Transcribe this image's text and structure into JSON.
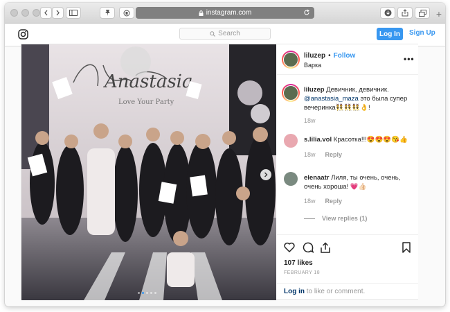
{
  "browser": {
    "url": "instagram.com",
    "icons": [
      "back-icon",
      "forward-icon",
      "sidebar-icon",
      "pin-icon",
      "privacy-icon",
      "lock-icon",
      "reload-icon",
      "download-icon",
      "share-icon",
      "tabs-icon",
      "new-tab-icon"
    ]
  },
  "header": {
    "search_placeholder": "Search",
    "login_label": "Log In",
    "signup_label": "Sign Up",
    "brand_color": "#3897f0"
  },
  "post": {
    "username": "liluzep",
    "separator": "•",
    "follow_label": "Follow",
    "location": "Варка",
    "more_label": "•••",
    "caption": {
      "username": "liluzep",
      "text_before": "Девичник, девичник.",
      "mention": "@anastasia_maza",
      "text_after": "это была супер вечеринка👯👯👯👌!",
      "time": "18w"
    },
    "comments": [
      {
        "username": "s.lilia.vol",
        "text": "Красотка!!!😍😍😍😘👍",
        "time": "18w",
        "reply_label": "Reply"
      },
      {
        "username": "elenaatr",
        "text": "Лиля, ты очень, очень, очень хороша! 💗👍🏻",
        "time": "18w",
        "reply_label": "Reply"
      }
    ],
    "view_replies": "View replies (1)",
    "likes": "107 likes",
    "date": "FEBRUARY 18",
    "login_link": "Log in",
    "login_rest": "to like or comment.",
    "carousel": {
      "count": 5,
      "active": 1
    },
    "backdrop_text": "Anastasia",
    "backdrop_subtext": "Love Your Party"
  }
}
